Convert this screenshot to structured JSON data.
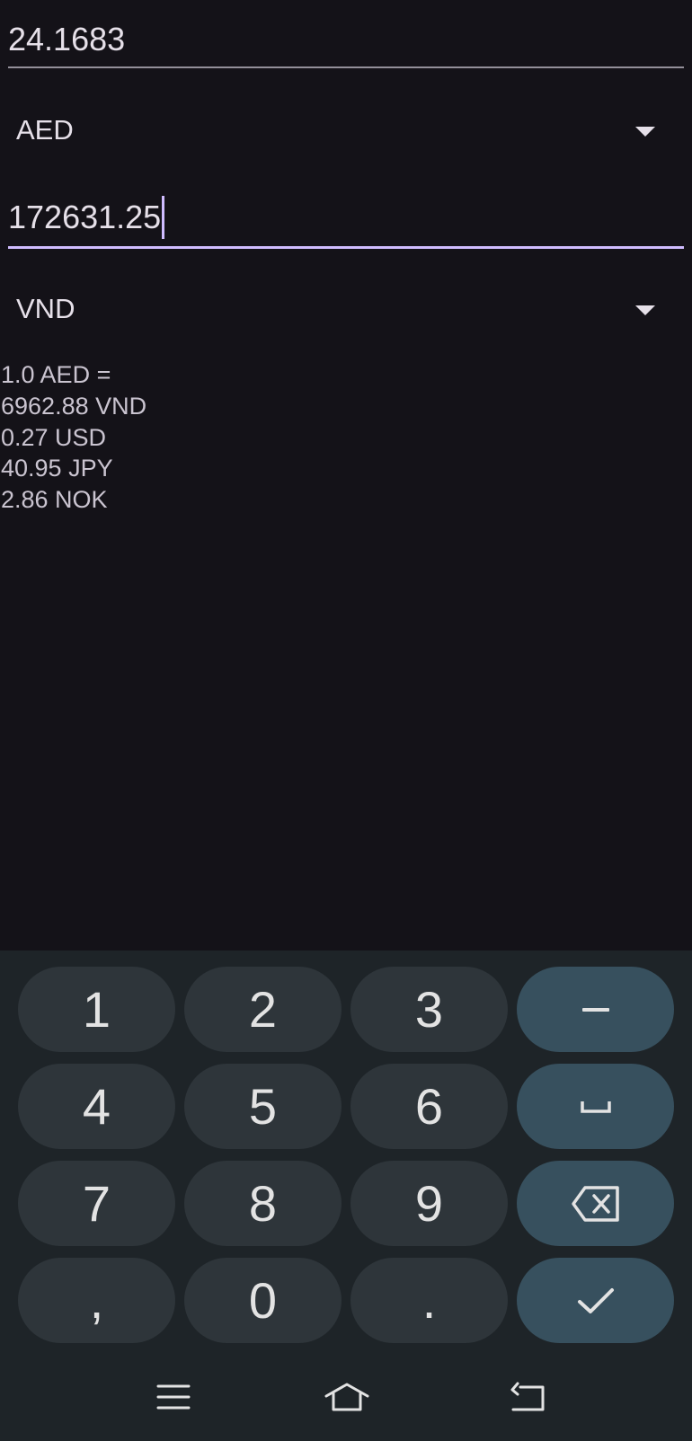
{
  "converter": {
    "from_amount": "24.1683",
    "from_currency": "AED",
    "to_amount": "172631.25",
    "to_currency": "VND"
  },
  "rates": {
    "base": "1.0 AED =",
    "lines": [
      "6962.88 VND",
      "0.27 USD",
      "40.95 JPY",
      "2.86 NOK"
    ]
  },
  "keyboard": {
    "keys": [
      "1",
      "2",
      "3",
      "4",
      "5",
      "6",
      "7",
      "8",
      "9",
      ",",
      "0",
      "."
    ],
    "icons": [
      "minus-icon",
      "space-icon",
      "backspace-icon",
      "check-icon"
    ]
  },
  "navbar": {
    "icons": [
      "menu-icon",
      "home-icon",
      "back-icon"
    ]
  },
  "colors": {
    "background": "#141218",
    "accent": "#d0bcff",
    "keyboard_bg": "#1e2428",
    "key_bg": "#2e353a",
    "func_key_bg": "#37505e"
  }
}
